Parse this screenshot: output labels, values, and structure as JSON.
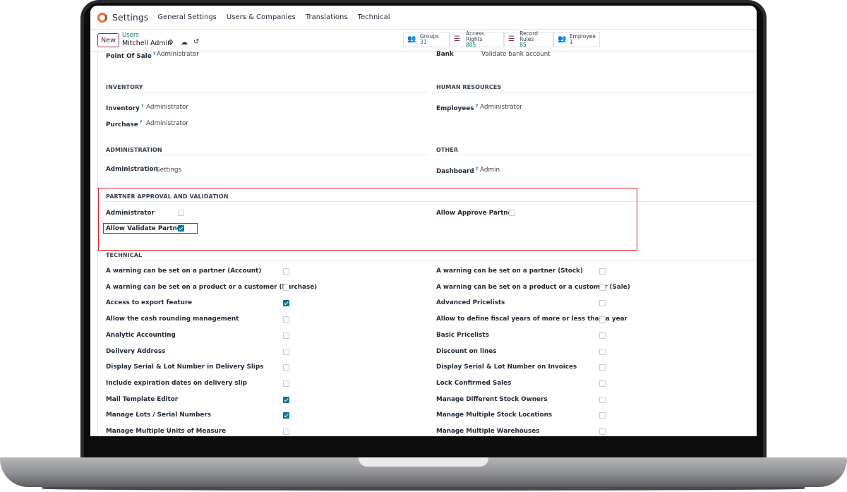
{
  "app": {
    "name": "Settings",
    "menu": [
      "General Settings",
      "Users & Companies",
      "Translations",
      "Technical"
    ]
  },
  "control": {
    "new_label": "New",
    "breadcrumb_parent": "Users",
    "breadcrumb_current": "Mitchell Admin",
    "stats": [
      {
        "label": "Groups",
        "value": "31"
      },
      {
        "label": "Access Rights",
        "value": "805"
      },
      {
        "label": "Record Rules",
        "value": "85"
      },
      {
        "label": "Employee",
        "value": "1"
      }
    ]
  },
  "top_row": {
    "left_label": "Point Of Sale",
    "left_value": "Administrator",
    "right_label": "Bank",
    "right_value": "Validate bank account"
  },
  "inventory": {
    "title": "INVENTORY",
    "rows": [
      {
        "label": "Inventory",
        "value": "Administrator"
      },
      {
        "label": "Purchase",
        "value": "Administrator"
      }
    ]
  },
  "human_resources": {
    "title": "HUMAN RESOURCES",
    "rows": [
      {
        "label": "Employees",
        "value": "Administrator"
      }
    ]
  },
  "administration": {
    "title": "ADMINISTRATION",
    "rows": [
      {
        "label": "Administration",
        "value": "Settings"
      }
    ]
  },
  "other": {
    "title": "OTHER",
    "rows": [
      {
        "label": "Dashboard",
        "value": "Admin"
      }
    ]
  },
  "partner": {
    "title": "PARTNER APPROVAL AND VALIDATION",
    "left": [
      {
        "label": "Administrator",
        "checked": false
      },
      {
        "label": "Allow Validate Partner",
        "checked": true
      }
    ],
    "right": [
      {
        "label": "Allow Approve Partner",
        "checked": false
      }
    ]
  },
  "technical": {
    "title": "TECHNICAL",
    "left": [
      {
        "label": "A warning can be set on a partner (Account)",
        "checked": false
      },
      {
        "label": "A warning can be set on a product or a customer (Purchase)",
        "checked": false
      },
      {
        "label": "Access to export feature",
        "checked": true
      },
      {
        "label": "Allow the cash rounding management",
        "checked": false
      },
      {
        "label": "Analytic Accounting",
        "checked": false
      },
      {
        "label": "Delivery Address",
        "checked": false
      },
      {
        "label": "Display Serial & Lot Number in Delivery Slips",
        "checked": false
      },
      {
        "label": "Include expiration dates on delivery slip",
        "checked": false
      },
      {
        "label": "Mail Template Editor",
        "checked": true
      },
      {
        "label": "Manage Lots / Serial Numbers",
        "checked": true
      },
      {
        "label": "Manage Multiple Units of Measure",
        "checked": false
      }
    ],
    "right": [
      {
        "label": "A warning can be set on a partner (Stock)",
        "checked": false
      },
      {
        "label": "A warning can be set on a product or a customer (Sale)",
        "checked": false
      },
      {
        "label": "Advanced Pricelists",
        "checked": false
      },
      {
        "label": "Allow to define fiscal years of more or less than a year",
        "checked": false
      },
      {
        "label": "Basic Pricelists",
        "checked": false
      },
      {
        "label": "Discount on lines",
        "checked": false
      },
      {
        "label": "Display Serial & Lot Number on Invoices",
        "checked": false
      },
      {
        "label": "Lock Confirmed Sales",
        "checked": false
      },
      {
        "label": "Manage Different Stock Owners",
        "checked": false
      },
      {
        "label": "Manage Multiple Stock Locations",
        "checked": false
      },
      {
        "label": "Manage Multiple Warehouses",
        "checked": false
      }
    ]
  },
  "colors": {
    "accent": "#0e7490",
    "brand": "#714b67",
    "highlight": "#d81f26"
  }
}
